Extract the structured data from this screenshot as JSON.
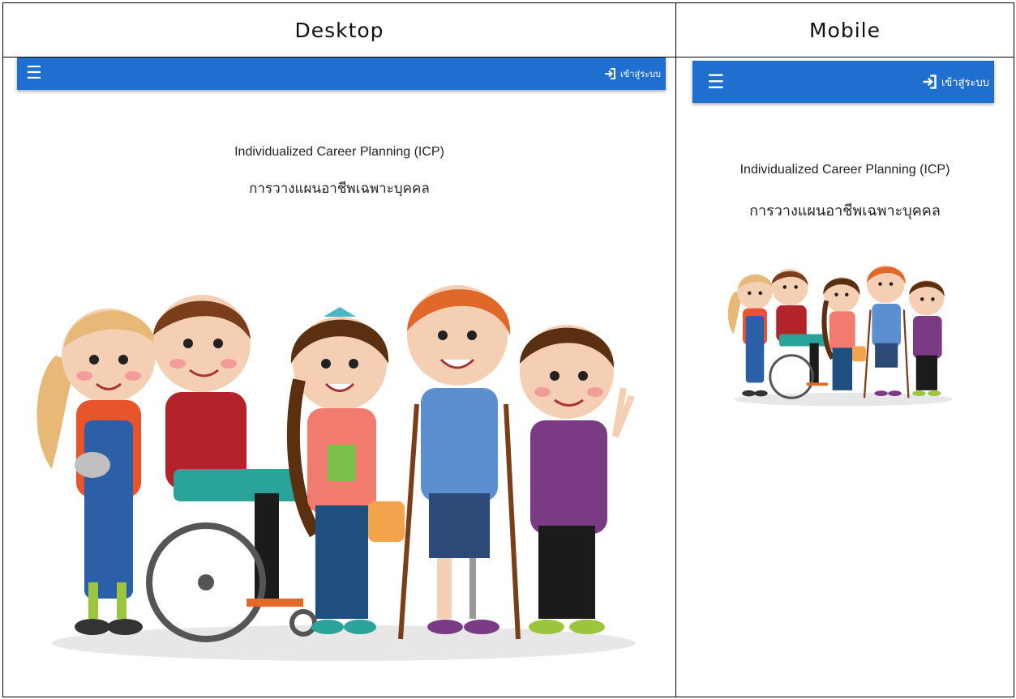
{
  "header": {
    "desktop_label": "Desktop",
    "mobile_label": "Mobile"
  },
  "app": {
    "login_label": "เข้าสู่ระบบ",
    "menu_icon": "hamburger-menu-icon",
    "login_icon": "login-arrow-icon",
    "title_en": "Individualized Career Planning (ICP)",
    "title_th": "การวางแผนอาชีพเฉพาะบุคคล",
    "accent_color": "#1f6fd1"
  },
  "illustration": {
    "people": [
      {
        "name": "girl-with-cat",
        "hair": "#e8b877",
        "shirt": "#e8552b",
        "pants": "#2b5fa8"
      },
      {
        "name": "boy-in-wheelchair",
        "hair": "#7a3f1a",
        "shirt": "#b3242a",
        "pants": "#1b1b1b"
      },
      {
        "name": "girl-with-braid",
        "hair": "#5a3010",
        "shirt": "#f07b6e",
        "pants": "#1e4f7e"
      },
      {
        "name": "boy-with-crutches",
        "hair": "#e0692a",
        "shirt": "#5b8fd0",
        "pants": "#2b4a78"
      },
      {
        "name": "boy-peace-sign",
        "hair": "#5a3010",
        "shirt": "#7b3b84",
        "pants": "#1b1b1b"
      }
    ]
  }
}
